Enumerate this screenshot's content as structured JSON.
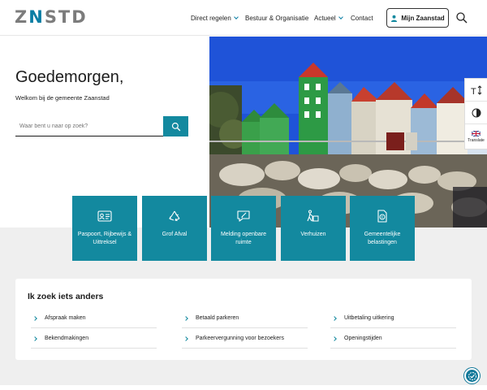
{
  "header": {
    "logo_text": "ZNSTD",
    "nav": [
      {
        "label": "Direct regelen",
        "has_dropdown": true
      },
      {
        "label": "Bestuur & Organisatie",
        "has_dropdown": false
      },
      {
        "label": "Actueel",
        "has_dropdown": true
      },
      {
        "label": "Contact",
        "has_dropdown": false
      }
    ],
    "account_button": "Mijn Zaanstad",
    "account_icon": "user-icon",
    "search_icon": "search-icon"
  },
  "hero": {
    "greeting": "Goedemorgen,",
    "welcome": "Welkom bij de gemeente Zaanstad",
    "search_placeholder": "Waar bent u naar op zoek?",
    "photo_description_icon": "hero-photo"
  },
  "rail": {
    "text_size_icon": "text-size-icon",
    "contrast_icon": "contrast-icon",
    "translate_label": "Translate",
    "flag_icon": "uk-flag-icon"
  },
  "tiles": [
    {
      "label": "Paspoort, Rijbewijs & Uittreksel",
      "icon": "id-card-icon"
    },
    {
      "label": "Grof Afval",
      "icon": "recycle-icon"
    },
    {
      "label": "Melding openbare ruimte",
      "icon": "report-message-icon"
    },
    {
      "label": "Verhuizen",
      "icon": "moving-icon"
    },
    {
      "label": "Gemeentelijke belastingen",
      "icon": "tax-document-icon"
    }
  ],
  "links_card": {
    "title": "Ik zoek iets anders",
    "links": [
      {
        "label": "Afspraak maken"
      },
      {
        "label": "Betaald parkeren"
      },
      {
        "label": "Uitbetaling uitkering"
      },
      {
        "label": "Bekendmakingen"
      },
      {
        "label": "Parkeervergunning voor bezoekers"
      },
      {
        "label": "Openingstijden"
      }
    ]
  },
  "colors": {
    "brand_teal": "#13899f",
    "logo_grey": "#7c7c7c",
    "band_grey": "#efefef"
  }
}
